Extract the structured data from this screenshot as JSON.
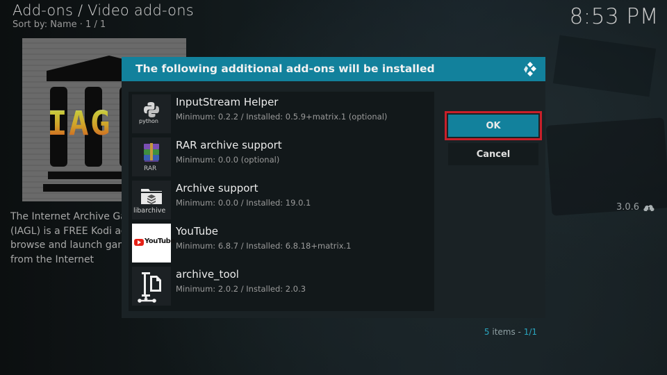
{
  "header": {
    "breadcrumb": "Add-ons / Video add-ons",
    "sort": "Sort by: Name  ·  1 / 1",
    "clock": "8:53 PM"
  },
  "addon": {
    "description_lines": [
      "The Internet Archive Game",
      "(IAGL) is a FREE Kodi addon",
      "browse and launch games",
      "from the Internet"
    ],
    "version": "3.0.6",
    "version_icon": "cloud-download-icon",
    "poster_letters": "IAG"
  },
  "dialog": {
    "title": "The following additional add-ons will be installed",
    "title_icon": "kodi-logo-icon",
    "items": [
      {
        "name": "InputStream Helper",
        "detail": "Minimum: 0.2.2 / Installed: 0.5.9+matrix.1 (optional)",
        "icon": "python-icon",
        "icon_label": "python"
      },
      {
        "name": "RAR archive support",
        "detail": "Minimum: 0.0.0 (optional)",
        "icon": "rar-icon",
        "icon_label": "RAR"
      },
      {
        "name": "Archive support",
        "detail": "Minimum: 0.0.0 / Installed: 19.0.1",
        "icon": "libarchive-icon",
        "icon_label": "libarchive"
      },
      {
        "name": "YouTube",
        "detail": "Minimum: 6.8.7 / Installed: 6.8.18+matrix.1",
        "icon": "youtube-icon",
        "icon_label": "YouTube"
      },
      {
        "name": "archive_tool",
        "detail": "Minimum: 2.0.2 / Installed: 2.0.3",
        "icon": "archive-tool-icon",
        "icon_label": ""
      }
    ],
    "ok_label": "OK",
    "cancel_label": "Cancel",
    "count_number": "5",
    "count_text": " items - ",
    "count_page": "1/1"
  },
  "colors": {
    "accent": "#12819c",
    "focus_outline": "#c8202a",
    "dialog_bg": "#1a2225"
  }
}
